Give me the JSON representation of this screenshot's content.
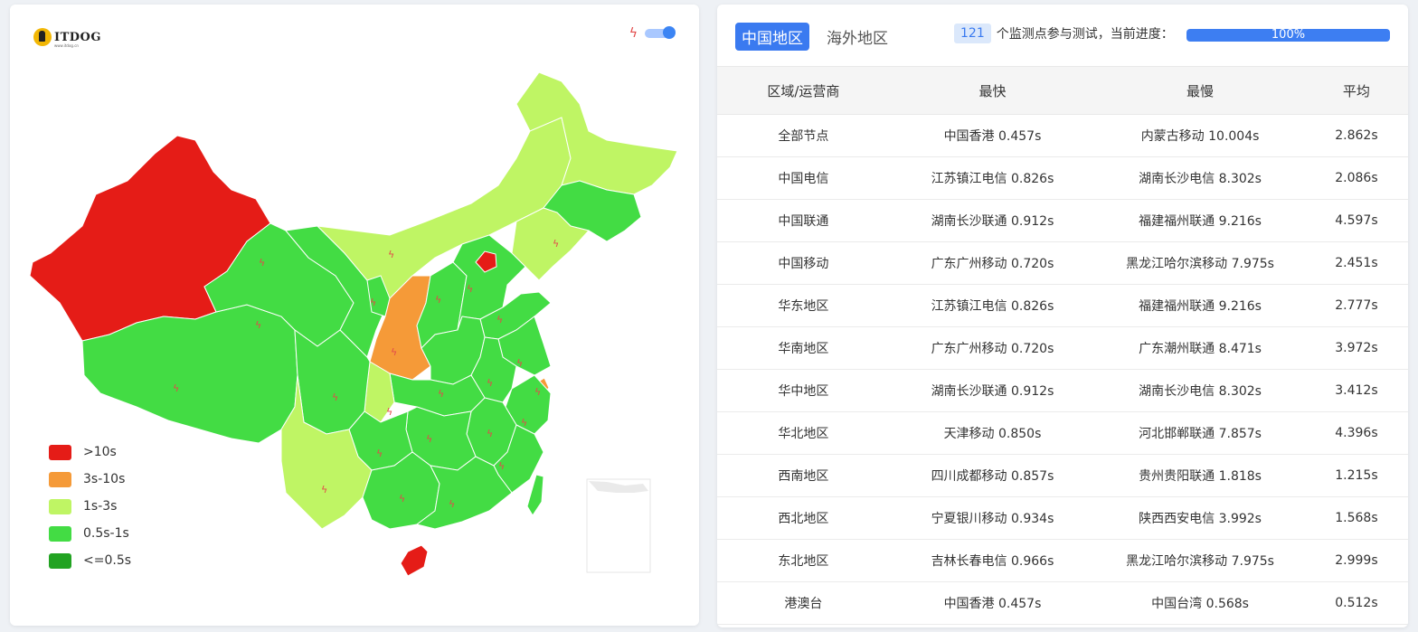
{
  "logo": {
    "text": "ITDOG",
    "sub": "www.itdog.cn"
  },
  "map": {
    "toggle_icon": "lightning-bolt-icon",
    "legend": [
      {
        "label": ">10s",
        "color": "#e51c17"
      },
      {
        "label": "3s-10s",
        "color": "#f59a38"
      },
      {
        "label": "1s-3s",
        "color": "#bff564"
      },
      {
        "label": "0.5s-1s",
        "color": "#43dc44"
      },
      {
        "label": "<=0.5s",
        "color": "#22a322"
      }
    ]
  },
  "header": {
    "tabs": [
      {
        "label": "中国地区",
        "active": true
      },
      {
        "label": "海外地区",
        "active": false
      }
    ],
    "monitor_count": "121",
    "monitor_text": "个监测点参与测试，当前进度：",
    "progress_label": "100%",
    "progress_value": 100
  },
  "table": {
    "columns": [
      "区域/运营商",
      "最快",
      "最慢",
      "平均"
    ],
    "rows": [
      [
        "全部节点",
        "中国香港 0.457s",
        "内蒙古移动 10.004s",
        "2.862s"
      ],
      [
        "中国电信",
        "江苏镇江电信 0.826s",
        "湖南长沙电信 8.302s",
        "2.086s"
      ],
      [
        "中国联通",
        "湖南长沙联通 0.912s",
        "福建福州联通 9.216s",
        "4.597s"
      ],
      [
        "中国移动",
        "广东广州移动 0.720s",
        "黑龙江哈尔滨移动 7.975s",
        "2.451s"
      ],
      [
        "华东地区",
        "江苏镇江电信 0.826s",
        "福建福州联通 9.216s",
        "2.777s"
      ],
      [
        "华南地区",
        "广东广州移动 0.720s",
        "广东潮州联通 8.471s",
        "3.972s"
      ],
      [
        "华中地区",
        "湖南长沙联通 0.912s",
        "湖南长沙电信 8.302s",
        "3.412s"
      ],
      [
        "华北地区",
        "天津移动 0.850s",
        "河北邯郸联通 7.857s",
        "4.396s"
      ],
      [
        "西南地区",
        "四川成都移动 0.857s",
        "贵州贵阳联通 1.818s",
        "1.215s"
      ],
      [
        "西北地区",
        "宁夏银川移动 0.934s",
        "陕西西安电信 3.992s",
        "1.568s"
      ],
      [
        "东北地区",
        "吉林长春电信 0.966s",
        "黑龙江哈尔滨移动 7.975s",
        "2.999s"
      ],
      [
        "港澳台",
        "中国香港 0.457s",
        "中国台湾 0.568s",
        "0.512s"
      ]
    ]
  }
}
